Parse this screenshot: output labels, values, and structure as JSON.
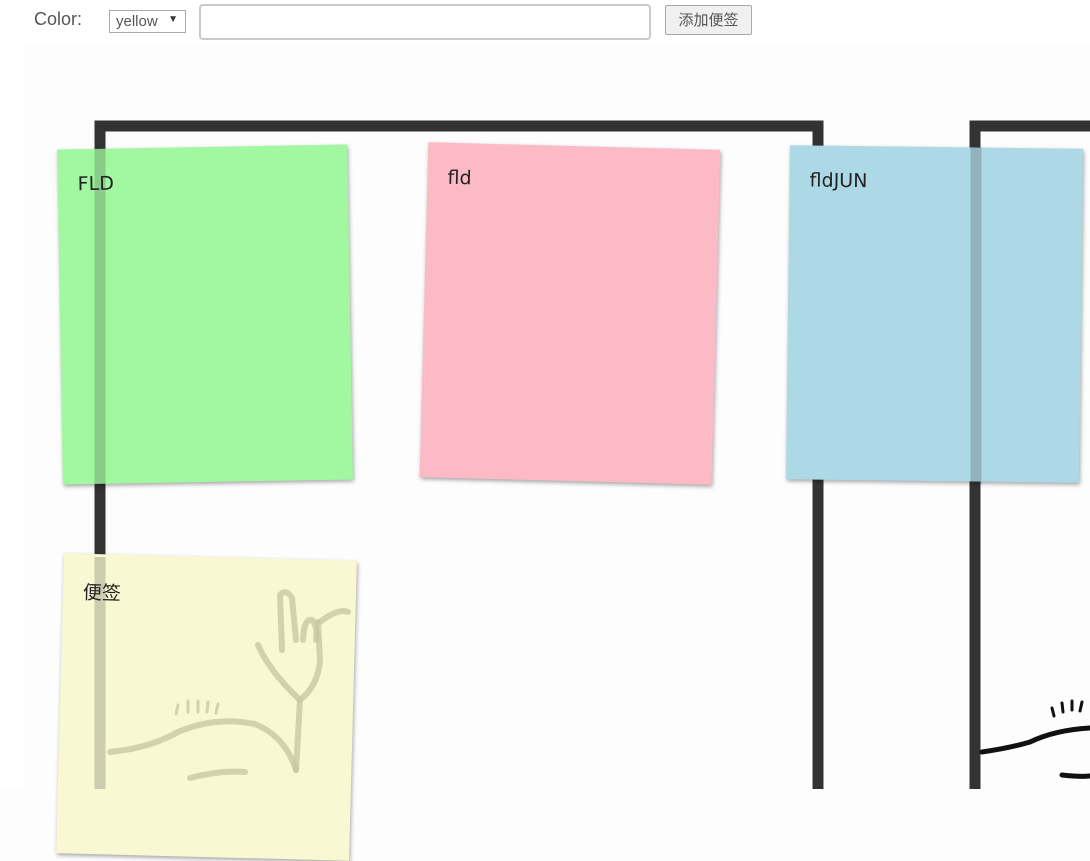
{
  "toolbar": {
    "color_label": "Color:",
    "color_select": {
      "selected": "yellow",
      "arrow_icon": "triangle-down-icon"
    },
    "note_input": {
      "value": "",
      "placeholder": ""
    },
    "add_button_label": "添加便签"
  },
  "notes": [
    {
      "text": "FLD",
      "color": "#a2f8a0"
    },
    {
      "text": "fld",
      "color": "#fbbac5"
    },
    {
      "text": "fldJUN",
      "color": "#add8e6"
    },
    {
      "text": "便签",
      "color": "#f8f8d2"
    }
  ],
  "colors": {
    "frame": "#333333",
    "page_background": "#fdfdfd"
  }
}
